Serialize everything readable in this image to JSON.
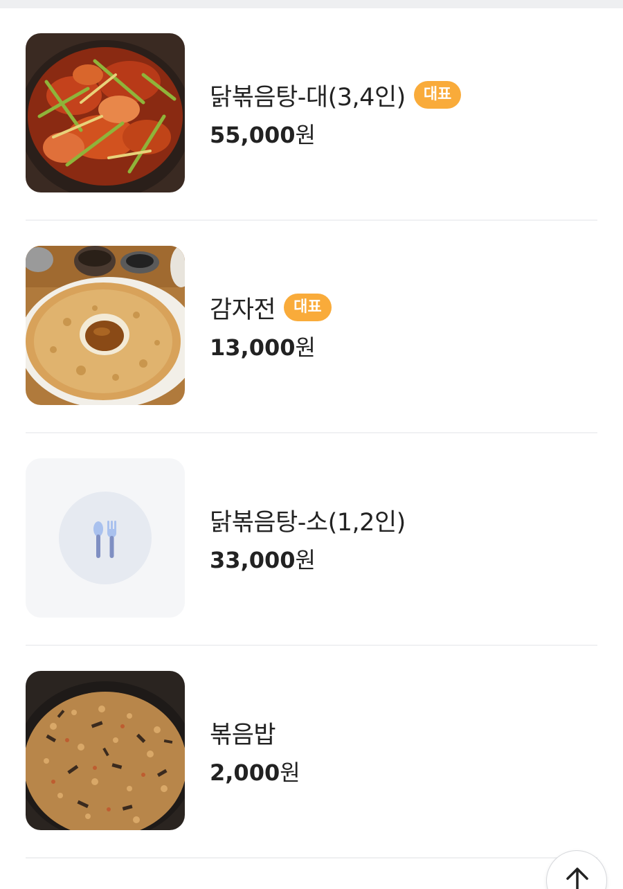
{
  "menu": {
    "items": [
      {
        "name": "닭볶음탕-대(3,4인)",
        "badge": "대표",
        "price": "55,000",
        "unit": "원",
        "photo": "spicy-braised-chicken-photo"
      },
      {
        "name": "감자전",
        "badge": "대표",
        "price": "13,000",
        "unit": "원",
        "photo": "potato-pancake-photo"
      },
      {
        "name": "닭볶음탕-소(1,2인)",
        "badge": "",
        "price": "33,000",
        "unit": "원",
        "photo": "no-image-placeholder"
      },
      {
        "name": "볶음밥",
        "badge": "",
        "price": "2,000",
        "unit": "원",
        "photo": "fried-rice-photo"
      }
    ]
  },
  "icons": {
    "placeholder": "spoon-fork-icon",
    "scroll_top": "arrow-up-icon"
  },
  "colors": {
    "badge_bg": "#f9ab3a",
    "badge_text": "#ffffff",
    "divider": "#f0f1f3",
    "placeholder_bg": "#f5f6f8",
    "placeholder_icon": "#8597c8"
  }
}
